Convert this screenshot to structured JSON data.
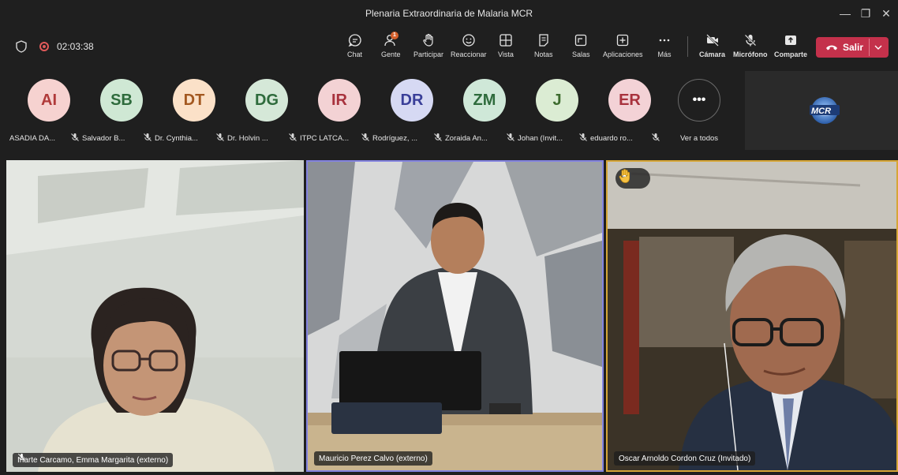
{
  "window": {
    "title": "Plenaria Extraordinaria de Malaria MCR",
    "minimize_glyph": "—",
    "maximize_glyph": "❐",
    "close_glyph": "✕"
  },
  "toolbar": {
    "timer": "02:03:38",
    "people_badge": "1",
    "items": [
      {
        "key": "chat",
        "label": "Chat",
        "icon": "chat-icon"
      },
      {
        "key": "people",
        "label": "Gente",
        "icon": "people-icon"
      },
      {
        "key": "raise",
        "label": "Participar",
        "icon": "raise-hand-icon"
      },
      {
        "key": "react",
        "label": "Reaccionar",
        "icon": "smiley-icon"
      },
      {
        "key": "view",
        "label": "Vista",
        "icon": "grid-icon"
      },
      {
        "key": "notes",
        "label": "Notas",
        "icon": "notes-icon"
      },
      {
        "key": "rooms",
        "label": "Salas",
        "icon": "rooms-icon"
      },
      {
        "key": "apps",
        "label": "Aplicaciones",
        "icon": "plus-icon"
      },
      {
        "key": "more",
        "label": "Más",
        "icon": "more-icon"
      },
      {
        "key": "camera",
        "label": "Cámara",
        "icon": "camera-off-icon"
      },
      {
        "key": "mic",
        "label": "Micrófono",
        "icon": "mic-off-icon"
      },
      {
        "key": "share",
        "label": "Comparte",
        "icon": "share-icon"
      }
    ],
    "leave_label": "Salir",
    "colors": {
      "leave": "#c4314b",
      "badge": "#d45f2b"
    }
  },
  "participants": [
    {
      "initials": "AI",
      "name": "ASADIA DA...",
      "bg": "#f6d2d0",
      "fg": "#b03a3a"
    },
    {
      "initials": "SB",
      "name": "Salvador B...",
      "bg": "#cfe8d4",
      "fg": "#2e6b3c"
    },
    {
      "initials": "DT",
      "name": "Dr. Cynthia...",
      "bg": "#fbe1c8",
      "fg": "#a35820"
    },
    {
      "initials": "DG",
      "name": "Dr. Holvin ...",
      "bg": "#d5e8d8",
      "fg": "#2e6b3c"
    },
    {
      "initials": "IR",
      "name": "ITPC LATCA...",
      "bg": "#f3d2d4",
      "fg": "#a8323d"
    },
    {
      "initials": "DR",
      "name": "Rodríguez, ...",
      "bg": "#d6d9f3",
      "fg": "#3a3f99"
    },
    {
      "initials": "ZM",
      "name": "Zoraida An...",
      "bg": "#cfe8d8",
      "fg": "#2e6b3c"
    },
    {
      "initials": "J",
      "name": "Johan (Invit...",
      "bg": "#dbecd3",
      "fg": "#3d6b2e"
    },
    {
      "initials": "ER",
      "name": "eduardo ro...",
      "bg": "#f3d2d6",
      "fg": "#a8323d"
    }
  ],
  "see_all": {
    "glyph": "•••",
    "label": "Ver a todos"
  },
  "org_logo_text": "MCR",
  "videos": [
    {
      "name": "Iriarte Carcamo, Emma Margarita (externo)",
      "muted": true
    },
    {
      "name": "Mauricio Perez Calvo (externo)",
      "muted": false
    },
    {
      "name": "Oscar Arnoldo Cordon Cruz (Invitado)",
      "muted": false,
      "hand_count": "1"
    }
  ]
}
